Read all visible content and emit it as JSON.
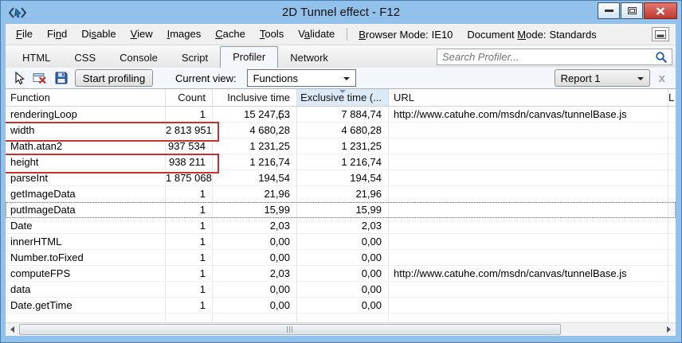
{
  "window": {
    "title": "2D Tunnel effect - F12"
  },
  "menu": {
    "items": [
      {
        "pre": "",
        "key": "F",
        "post": "ile"
      },
      {
        "pre": "Fi",
        "key": "n",
        "post": "d"
      },
      {
        "pre": "Di",
        "key": "s",
        "post": "able"
      },
      {
        "pre": "",
        "key": "V",
        "post": "iew"
      },
      {
        "pre": "",
        "key": "I",
        "post": "mages"
      },
      {
        "pre": "",
        "key": "C",
        "post": "ache"
      },
      {
        "pre": "",
        "key": "T",
        "post": "ools"
      },
      {
        "pre": "V",
        "key": "a",
        "post": "lidate"
      }
    ],
    "browser_mode": {
      "pre": "",
      "key": "B",
      "post": "rowser Mode:",
      "value": "IE10"
    },
    "document_mode": {
      "pre": "Document ",
      "key": "M",
      "post": "ode:",
      "value": "Standards"
    }
  },
  "tabs": [
    "HTML",
    "CSS",
    "Console",
    "Script",
    "Profiler",
    "Network"
  ],
  "search": {
    "placeholder": "Search Profiler..."
  },
  "toolbar": {
    "start_button": "Start profiling",
    "current_view_label": "Current view:",
    "view_value": "Functions",
    "report_value": "Report 1",
    "close_report_glyph": "x"
  },
  "table": {
    "columns": [
      "Function",
      "Count",
      "Inclusive time (...",
      "Exclusive time (...",
      "URL",
      "L"
    ],
    "sorted_column": "Exclusive time (...",
    "rows": [
      {
        "function": "renderingLoop",
        "count": "1",
        "inclusive": "15 247,53",
        "exclusive": "7 884,74",
        "url": "http://www.catuhe.com/msdn/canvas/tunnelBase.js"
      },
      {
        "function": "width",
        "count": "2 813 951",
        "inclusive": "4 680,28",
        "exclusive": "4 680,28",
        "url": ""
      },
      {
        "function": "Math.atan2",
        "count": "937 534",
        "inclusive": "1 231,25",
        "exclusive": "1 231,25",
        "url": ""
      },
      {
        "function": "height",
        "count": "938 211",
        "inclusive": "1 216,74",
        "exclusive": "1 216,74",
        "url": ""
      },
      {
        "function": "parseInt",
        "count": "1 875 068",
        "inclusive": "194,54",
        "exclusive": "194,54",
        "url": ""
      },
      {
        "function": "getImageData",
        "count": "1",
        "inclusive": "21,96",
        "exclusive": "21,96",
        "url": ""
      },
      {
        "function": "putImageData",
        "count": "1",
        "inclusive": "15,99",
        "exclusive": "15,99",
        "url": ""
      },
      {
        "function": "Date",
        "count": "1",
        "inclusive": "2,03",
        "exclusive": "2,03",
        "url": ""
      },
      {
        "function": "innerHTML",
        "count": "1",
        "inclusive": "0,00",
        "exclusive": "0,00",
        "url": ""
      },
      {
        "function": "Number.toFixed",
        "count": "1",
        "inclusive": "0,00",
        "exclusive": "0,00",
        "url": ""
      },
      {
        "function": "computeFPS",
        "count": "1",
        "inclusive": "2,03",
        "exclusive": "0,00",
        "url": "http://www.catuhe.com/msdn/canvas/tunnelBase.js"
      },
      {
        "function": "data",
        "count": "1",
        "inclusive": "0,00",
        "exclusive": "0,00",
        "url": ""
      },
      {
        "function": "Date.getTime",
        "count": "1",
        "inclusive": "0,00",
        "exclusive": "0,00",
        "url": ""
      }
    ],
    "annotations": {
      "red_boxed_rows": [
        1,
        3
      ],
      "focused_row": 6
    }
  },
  "colors": {
    "window_chrome": "#92C1EC",
    "annotation_red": "#C8322B",
    "sorted_header_bg": "#DCEAF7",
    "close_button_red": "#BC3A30"
  }
}
